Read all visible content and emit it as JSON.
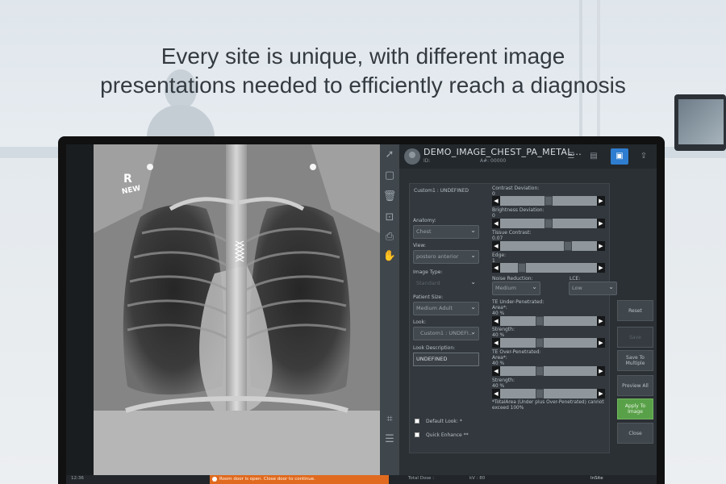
{
  "headline": {
    "line1": "Every site is unique, with different image",
    "line2": "presentations needed to efficiently reach a diagnosis"
  },
  "xray": {
    "marker_side": "R",
    "marker_sub": "NEW"
  },
  "tools": {
    "icons": [
      "cursor-icon",
      "select-box-icon",
      "trash-icon",
      "user-scan-icon",
      "print-icon",
      "hand-icon",
      "crop-icon",
      "checklist-icon"
    ]
  },
  "header": {
    "image_title": "DEMO_IMAGE_CHEST_PA_METAL...",
    "id_label": "ID:",
    "acc_label": "A#: 00000"
  },
  "look_panel": {
    "look_name": "Custom1 : UNDEFINED",
    "anatomy": {
      "label": "Anatomy:",
      "value": "Chest"
    },
    "view": {
      "label": "View:",
      "value": "postero anterior"
    },
    "image_type": {
      "label": "Image Type:",
      "value": "Standard"
    },
    "patient_size": {
      "label": "Patient Size:",
      "value": "Medium Adult"
    },
    "look": {
      "label": "Look:",
      "value": "Custom1 : UNDEFI..."
    },
    "look_description": {
      "label": "Look Description:",
      "value": "UNDEFINED"
    },
    "default_look_label": "Default Look: *",
    "quick_enhance_label": "Quick Enhance **",
    "contrast_deviation": {
      "label": "Contrast Deviation:",
      "value": "0",
      "position": 0.5
    },
    "brightness_deviation": {
      "label": "Brightness Deviation:",
      "value": "0",
      "position": 0.5
    },
    "tissue_contrast": {
      "label": "Tissue Contrast:",
      "value": "0.07",
      "position": 0.72
    },
    "edge": {
      "label": "Edge:",
      "value": "1",
      "position": 0.2
    },
    "noise_reduction": {
      "label": "Noise Reduction:",
      "value": "Medium"
    },
    "lce": {
      "label": "LCE:",
      "value": "Low"
    },
    "te_under": {
      "title": "TE Under-Penetrated:",
      "area": {
        "label": "Area*:",
        "value": "40 %",
        "position": 0.4
      },
      "strength": {
        "label": "Strength:",
        "value": "40 %",
        "position": 0.4
      }
    },
    "te_over": {
      "title": "TE Over-Penetrated:",
      "area": {
        "label": "Area*:",
        "value": "40 %",
        "position": 0.4
      },
      "strength": {
        "label": "Strength:",
        "value": "40 %",
        "position": 0.4
      }
    },
    "total_area_note": "*TotalArea (Under plus Over-Penetrated) cannot exceed 100%"
  },
  "side_buttons": {
    "reset": "Reset",
    "save": "Save",
    "save_to_multiple": "Save To Multiple",
    "preview_all": "Preview All",
    "apply_to_image": "Apply To Image",
    "close": "Close"
  },
  "status_bar": {
    "time": "12:36",
    "warning": "Room door is open. Close door to continue.",
    "total_dose": "Total Dose :",
    "kv": "kV : 80",
    "insite": "InSite"
  },
  "colors": {
    "accent": "#2f7dd0",
    "apply_green": "#59a148",
    "warning_orange": "#e06a1f"
  }
}
